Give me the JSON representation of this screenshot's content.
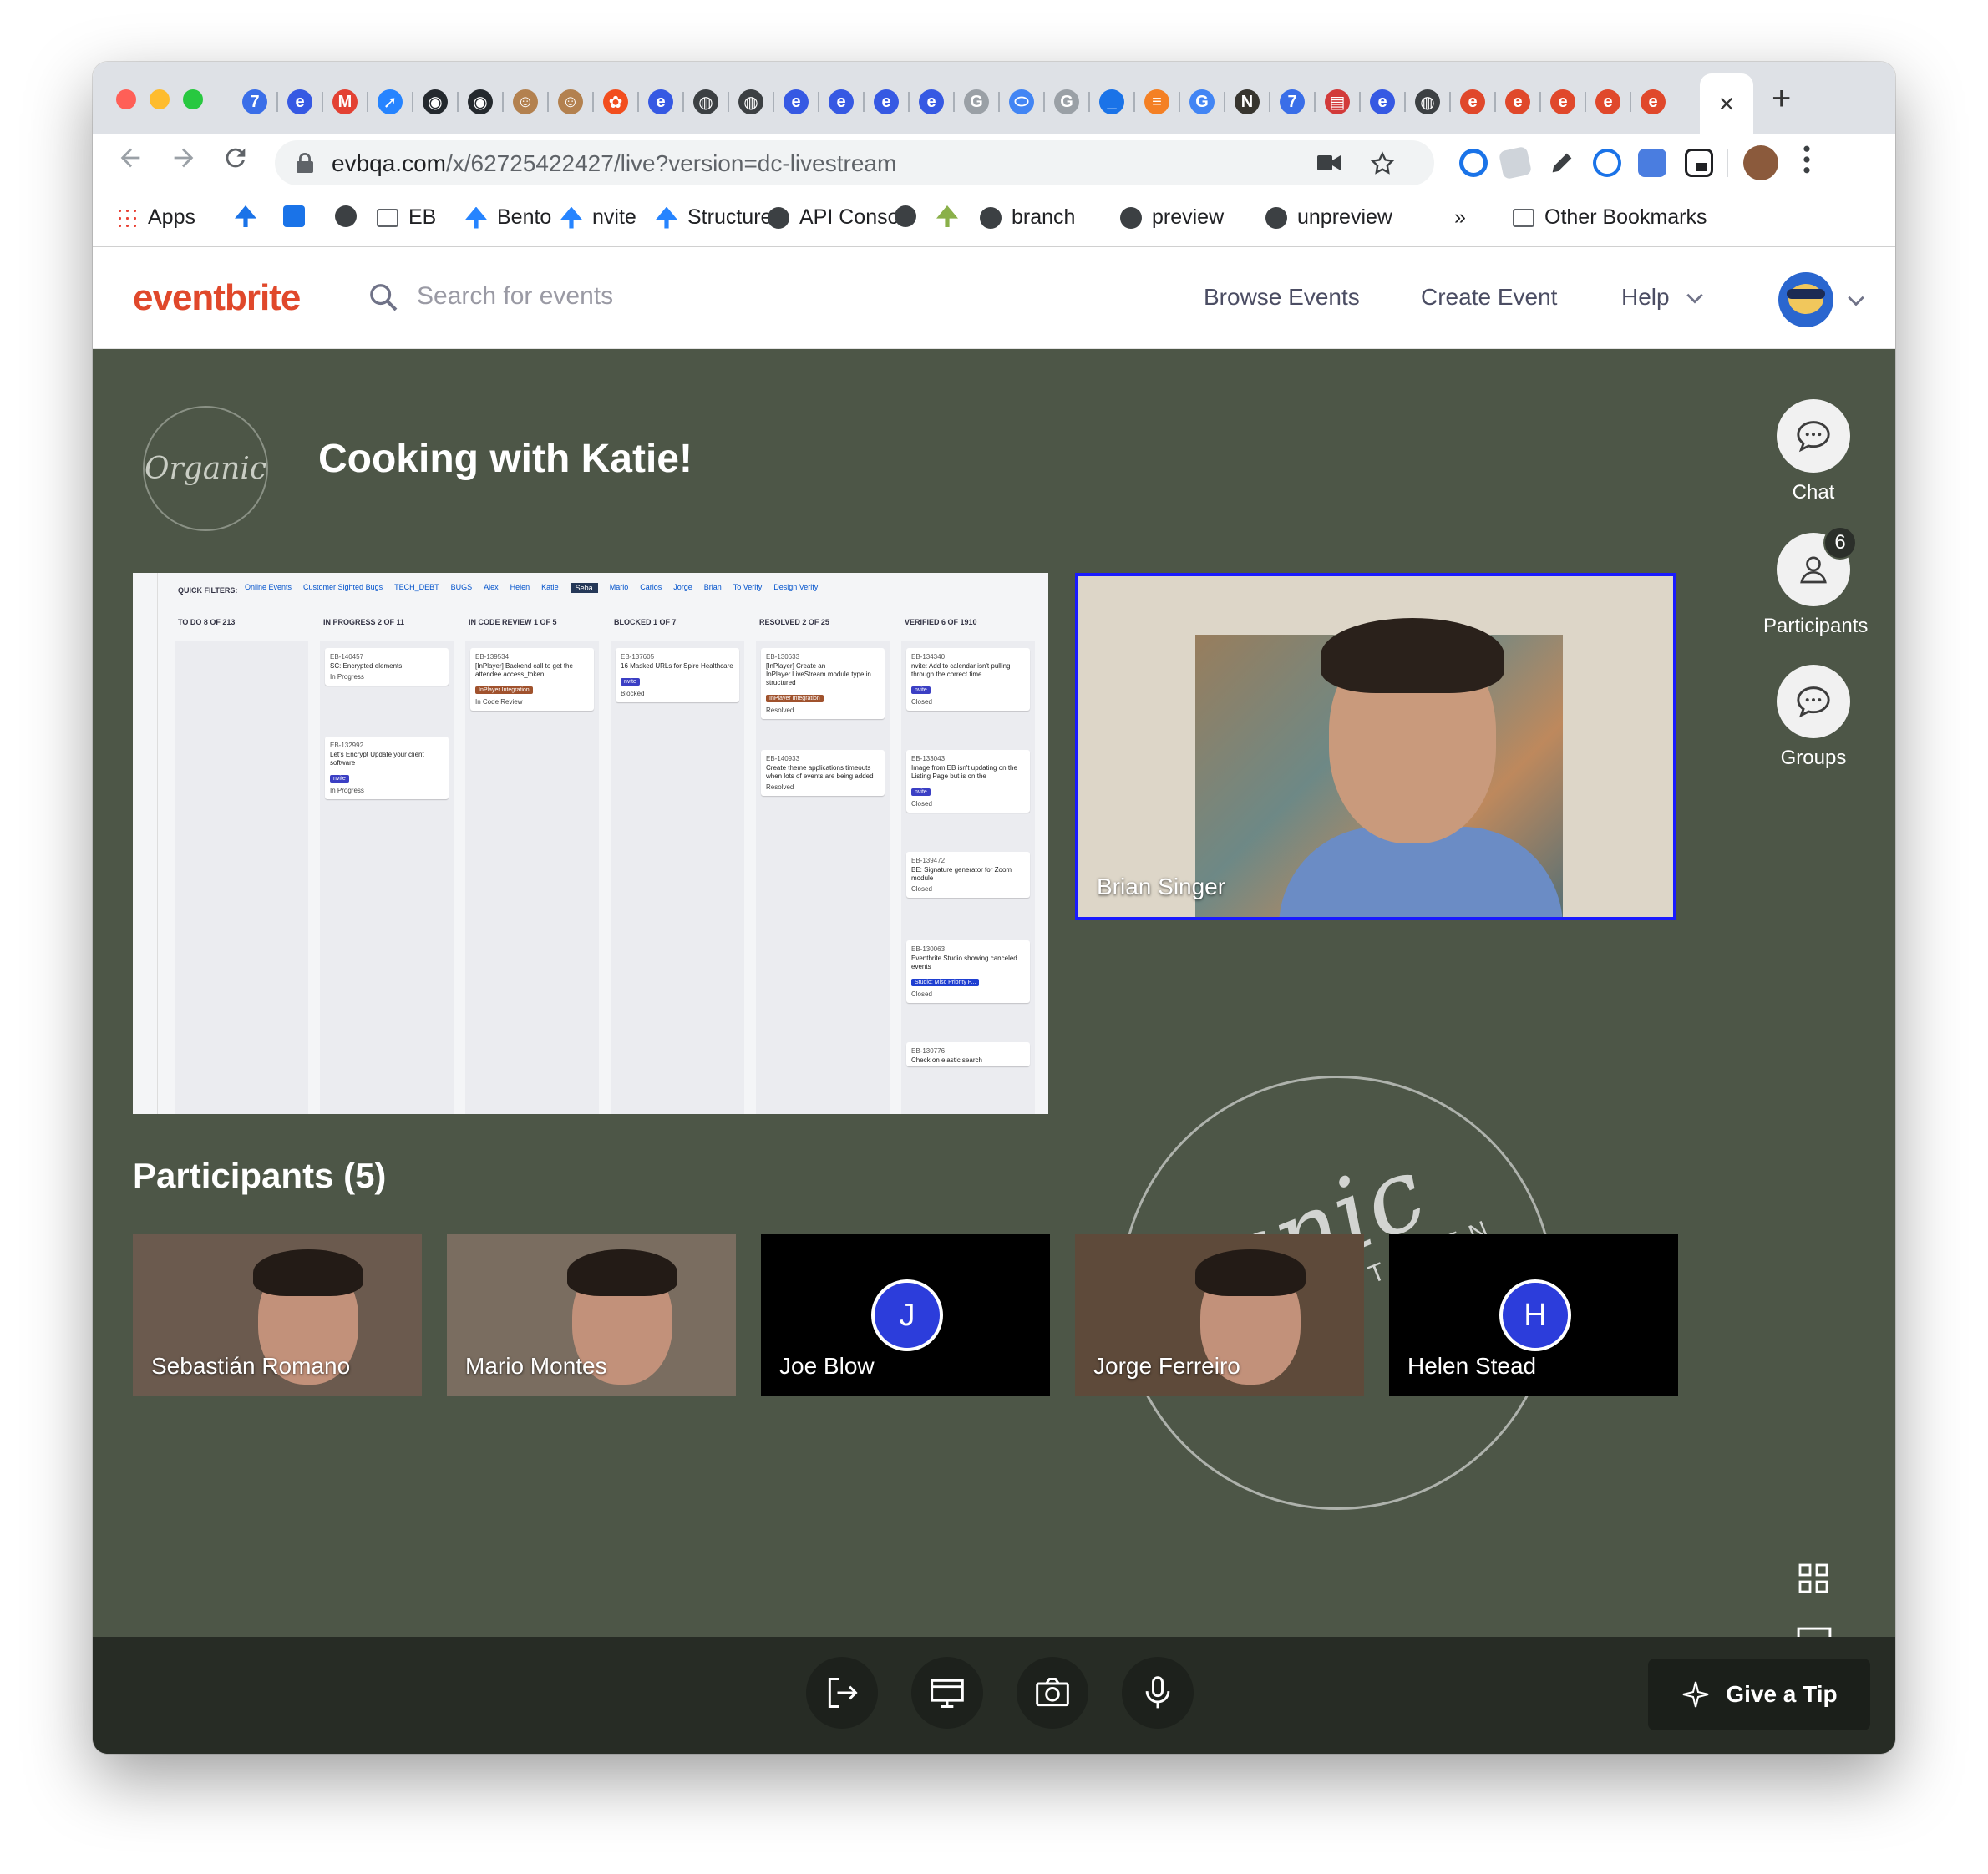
{
  "browser": {
    "url_host": "evbqa.com",
    "url_path": "/x/62725422427/live?version=dc-livestream",
    "tab_close_glyph": "×",
    "new_tab_glyph": "+",
    "tabs": [
      {
        "icon": "calendar-icon",
        "color": "#3a6ee8",
        "glyph": "7"
      },
      {
        "icon": "e-icon",
        "color": "#3659e3",
        "glyph": "e"
      },
      {
        "icon": "gmail-icon",
        "color": "#e34133",
        "glyph": "M"
      },
      {
        "icon": "jira-icon",
        "color": "#2684ff",
        "glyph": "➚"
      },
      {
        "icon": "github-icon",
        "color": "#24292e",
        "glyph": "◉"
      },
      {
        "icon": "github-icon",
        "color": "#24292e",
        "glyph": "◉"
      },
      {
        "icon": "jenkins-icon",
        "color": "#b3814f",
        "glyph": "☺"
      },
      {
        "icon": "jenkins-icon",
        "color": "#b3814f",
        "glyph": "☺"
      },
      {
        "icon": "figma-icon",
        "color": "#f24e1e",
        "glyph": "✿"
      },
      {
        "icon": "e-icon",
        "color": "#3659e3",
        "glyph": "e"
      },
      {
        "icon": "globe-icon",
        "color": "#3c4043",
        "glyph": "◍"
      },
      {
        "icon": "globe-icon",
        "color": "#3c4043",
        "glyph": "◍"
      },
      {
        "icon": "e-icon",
        "color": "#3659e3",
        "glyph": "e"
      },
      {
        "icon": "e-icon",
        "color": "#3659e3",
        "glyph": "e"
      },
      {
        "icon": "e-icon",
        "color": "#3659e3",
        "glyph": "e"
      },
      {
        "icon": "e-icon",
        "color": "#3659e3",
        "glyph": "e"
      },
      {
        "icon": "google-icon",
        "color": "#9aa0a6",
        "glyph": "G"
      },
      {
        "icon": "drive-icon",
        "color": "#4285f4",
        "glyph": "⬭"
      },
      {
        "icon": "google-icon",
        "color": "#9aa0a6",
        "glyph": "G"
      },
      {
        "icon": "dash-icon",
        "color": "#1a73e8",
        "glyph": "_"
      },
      {
        "icon": "stackoverflow-icon",
        "color": "#f48024",
        "glyph": "≡"
      },
      {
        "icon": "google-icon",
        "color": "#4285f4",
        "glyph": "G"
      },
      {
        "icon": "notion-icon",
        "color": "#37352f",
        "glyph": "N"
      },
      {
        "icon": "calendar-icon",
        "color": "#3a6ee8",
        "glyph": "7"
      },
      {
        "icon": "clapper-icon",
        "color": "#d23a3a",
        "glyph": "▤"
      },
      {
        "icon": "e-icon",
        "color": "#3659e3",
        "glyph": "e"
      },
      {
        "icon": "globe-icon",
        "color": "#3c4043",
        "glyph": "◍"
      },
      {
        "icon": "e-icon",
        "color": "#e0482b",
        "glyph": "e"
      },
      {
        "icon": "e-icon",
        "color": "#e0482b",
        "glyph": "e"
      },
      {
        "icon": "e-icon",
        "color": "#e0482b",
        "glyph": "e"
      },
      {
        "icon": "e-icon",
        "color": "#e0482b",
        "glyph": "e"
      },
      {
        "icon": "e-icon",
        "color": "#e0482b",
        "glyph": "e"
      }
    ],
    "bookmarks": [
      {
        "label": "Apps",
        "icon": "apps-grid-icon"
      },
      {
        "label": "",
        "icon": "download-icon"
      },
      {
        "label": "",
        "icon": "checkbox-icon"
      },
      {
        "label": "",
        "icon": "globe-icon"
      },
      {
        "label": "EB",
        "icon": "folder-icon"
      },
      {
        "label": "Bento",
        "icon": "jira-icon"
      },
      {
        "label": "nvite",
        "icon": "jira-icon"
      },
      {
        "label": "Structure",
        "icon": "jira-icon"
      },
      {
        "label": "API Console",
        "icon": "globe-icon"
      },
      {
        "label": "",
        "icon": "globe-icon"
      },
      {
        "label": "",
        "icon": "pencil-icon"
      },
      {
        "label": "branch",
        "icon": "globe-icon"
      },
      {
        "label": "preview",
        "icon": "globe-icon"
      },
      {
        "label": "unpreview",
        "icon": "globe-icon"
      },
      {
        "label": "»",
        "icon": ""
      },
      {
        "label": "Other Bookmarks",
        "icon": "folder-icon"
      }
    ]
  },
  "header": {
    "logo": "eventbrite",
    "search_placeholder": "Search for events",
    "nav": [
      "Browse Events",
      "Create Event",
      "Help"
    ]
  },
  "event": {
    "brand_logo_text": "Organic",
    "title": "Cooking with Katie!",
    "speaker_name": "Brian Singer",
    "participants_heading": "Participants (5)",
    "participants": [
      {
        "name": "Sebastián Romano",
        "video": true,
        "bg": "#6b5a4e",
        "initial": ""
      },
      {
        "name": "Mario Montes",
        "video": true,
        "bg": "#7a6d60",
        "initial": ""
      },
      {
        "name": "Joe Blow",
        "video": false,
        "bg": "#000000",
        "initial": "J"
      },
      {
        "name": "Jorge Ferreiro",
        "video": true,
        "bg": "#5e4a3a",
        "initial": ""
      },
      {
        "name": "Helen Stead",
        "video": false,
        "bg": "#000000",
        "initial": "H"
      }
    ],
    "watermark_text": "anic",
    "watermark_sub": "TCHEN"
  },
  "rail": {
    "chat": "Chat",
    "participants": "Participants",
    "participants_count": "6",
    "groups": "Groups"
  },
  "controls": {
    "tip_label": "Give a Tip"
  },
  "screenshare": {
    "filters_label": "QUICK FILTERS:",
    "filters": [
      "Online Events",
      "Customer Sighted Bugs",
      "TECH_DEBT",
      "BUGS",
      "Alex",
      "Helen",
      "Katie",
      "Seba",
      "Mario",
      "Carlos",
      "Jorge",
      "Brian",
      "To Verify",
      "Design Verify"
    ],
    "columns": [
      {
        "title": "TO DO 8 OF 213",
        "cards": []
      },
      {
        "title": "IN PROGRESS 2 OF 11",
        "cards": [
          {
            "key": "EB-140457",
            "text": "SC: Encrypted elements",
            "tag": "",
            "tagc": "",
            "status": "In Progress"
          },
          {
            "key": "EB-132992",
            "text": "Let's Encrypt Update your client software",
            "tag": "nvite",
            "tagc": "#3b3fc4",
            "status": "In Progress"
          }
        ]
      },
      {
        "title": "IN CODE REVIEW 1 OF 5",
        "cards": [
          {
            "key": "EB-139534",
            "text": "[InPlayer] Backend call to get the attendee access_token",
            "tag": "InPlayer Integration",
            "tagc": "#a0522d",
            "status": "In Code Review"
          }
        ]
      },
      {
        "title": "BLOCKED 1 OF 7",
        "cards": [
          {
            "key": "EB-137605",
            "text": "16 Masked URLs for Spire Healthcare",
            "tag": "nvite",
            "tagc": "#3b3fc4",
            "status": "Blocked"
          }
        ]
      },
      {
        "title": "RESOLVED 2 OF 25",
        "cards": [
          {
            "key": "EB-130633",
            "text": "[InPlayer] Create an InPlayer.LiveStream module type in structured",
            "tag": "InPlayer Integration",
            "tagc": "#a0522d",
            "status": "Resolved"
          },
          {
            "key": "EB-140933",
            "text": "Create theme applications timeouts when lots of events are being added",
            "tag": "",
            "tagc": "",
            "status": "Resolved"
          }
        ]
      },
      {
        "title": "VERIFIED 6 OF 1910",
        "cards": [
          {
            "key": "EB-134340",
            "text": "nvite: Add to calendar isn't pulling through the correct time.",
            "tag": "nvite",
            "tagc": "#3b3fc4",
            "status": "Closed"
          },
          {
            "key": "EB-133043",
            "text": "Image from EB isn't updating on the Listing Page but is on the",
            "tag": "nvite",
            "tagc": "#3b3fc4",
            "status": "Closed"
          },
          {
            "key": "EB-139472",
            "text": "BE: Signature generator for Zoom module",
            "tag": "",
            "tagc": "",
            "status": "Closed"
          },
          {
            "key": "EB-130063",
            "text": "Eventbrite Studio showing canceled events",
            "tag": "Studio: Misc Priority P...",
            "tagc": "#1f3fd1",
            "status": "Closed"
          },
          {
            "key": "EB-130776",
            "text": "Check on elastic search",
            "tag": "",
            "tagc": "",
            "status": ""
          }
        ]
      }
    ]
  }
}
